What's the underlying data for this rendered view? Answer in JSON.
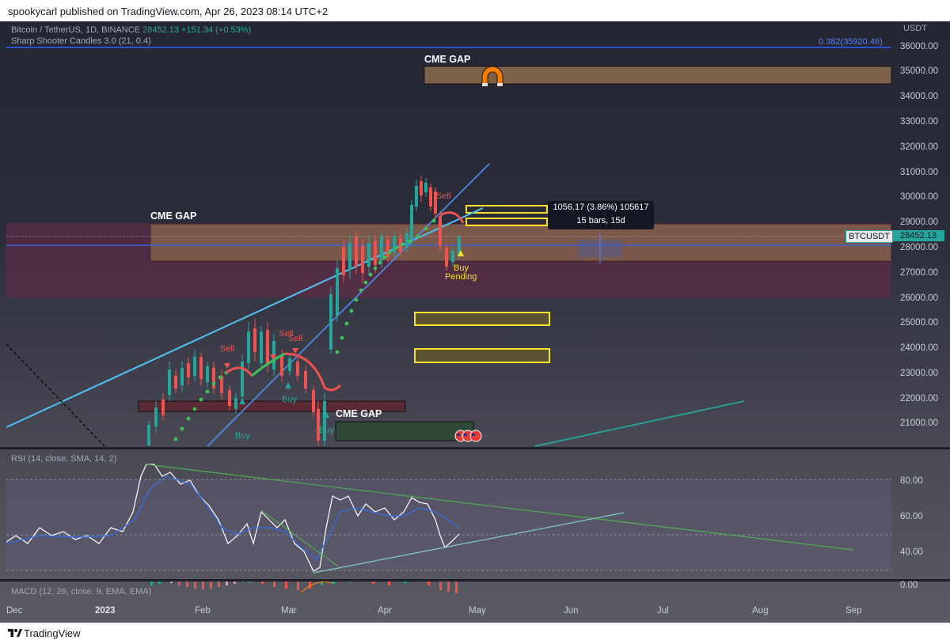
{
  "header": {
    "publisher": "spookycarl published on TradingView.com, Apr 26, 2023 08:14 UTC+2"
  },
  "main_pane": {
    "symbol": "Bitcoin / TetherUS, 1D, BINANCE",
    "last_price": "28452.13",
    "change": "+151.34 (+0.53%)",
    "indicator": "Sharp Shooter Candles 3.0 (21, 0.4)",
    "currency": "USDT",
    "fib_label": "0.382(35920.46)",
    "price_axis": [
      "36000.00",
      "35000.00",
      "34000.00",
      "33000.00",
      "32000.00",
      "31000.00",
      "30000.00",
      "29000.00",
      "28000.00",
      "27000.00",
      "26000.00",
      "25000.00",
      "24000.00",
      "23000.00",
      "22000.00",
      "21000.00"
    ],
    "ticker_tag": "BTCUSDT",
    "price_tag": "28452.13",
    "tooltip": {
      "line1": "1056.17 (3.86%) 105617",
      "line2": "15 bars, 15d"
    },
    "annotations": {
      "cme_top": "CME GAP",
      "cme_mid": "CME GAP",
      "cme_low": "CME GAP",
      "buy_pending_1": "Buy",
      "buy_pending_2": "Pending",
      "sell_1": "Sell",
      "sell_2": "Sell",
      "sell_3": "Sell",
      "sell_4": "Sell",
      "buy_1": "Buy",
      "buy_2": "Buy",
      "buy_3": "Buy"
    }
  },
  "rsi_pane": {
    "label": "RSI (14, close, SMA, 14, 2)",
    "axis": [
      "80.00",
      "60.00",
      "40.00"
    ]
  },
  "macd_pane": {
    "label": "MACD (12, 26, close, 9, EMA, EMA)",
    "axis": [
      "0.00"
    ]
  },
  "time_axis": [
    "Dec",
    "2023",
    "Feb",
    "Mar",
    "Apr",
    "May",
    "Jun",
    "Jul",
    "Aug",
    "Sep"
  ],
  "footer": {
    "brand": "TradingView"
  },
  "colors": {
    "up": "#26a69a",
    "down": "#ef5350",
    "accent": "#2962ff",
    "cme_zone": "#8a7150",
    "highlight_box": "#f5e02a",
    "resistance_zone": "#5d2a3f"
  },
  "icons": [
    "magnet-icon",
    "flag-icon",
    "tradingview-logo-icon"
  ]
}
